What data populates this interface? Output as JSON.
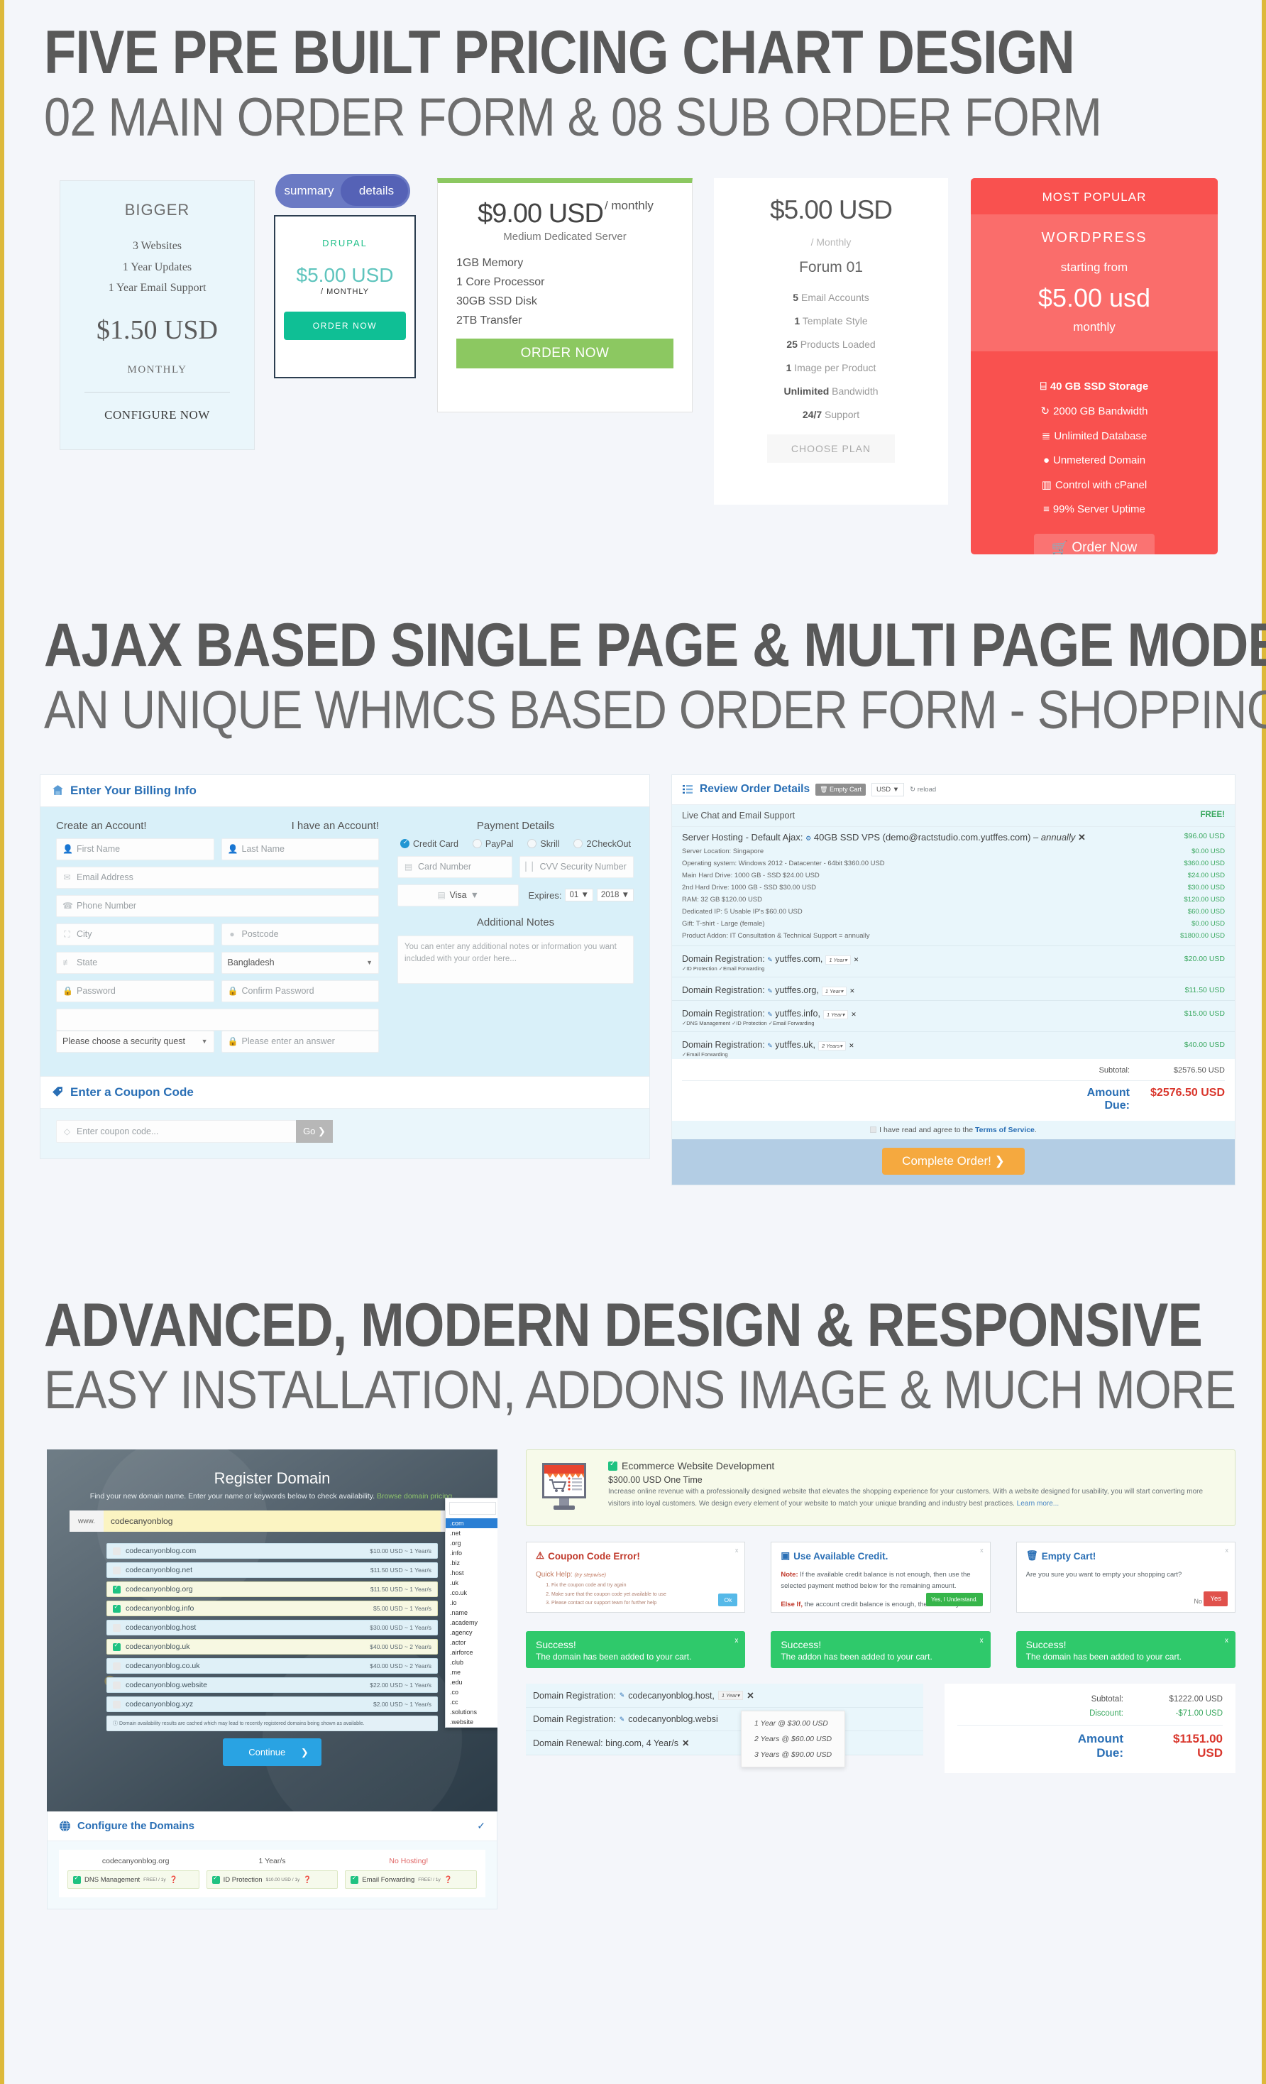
{
  "hero": {
    "line1": "FIVE PRE BUILT PRICING CHART DESIGN",
    "line2": "02 MAIN ORDER FORM & 08 SUB ORDER FORM"
  },
  "hero2": {
    "line1": "AJAX BASED SINGLE PAGE & MULTI PAGE MODE",
    "line2": "AN UNIQUE WHMCS BASED ORDER FORM - SHOPPING CART"
  },
  "hero3": {
    "line1": "ADVANCED, MODERN DESIGN & RESPONSIVE",
    "line2": "EASY INSTALLATION, ADDONS IMAGE & MUCH MORE"
  },
  "colors": {
    "accent_blue": "#2a6fb5",
    "green": "#3aa85f",
    "red": "#f9514f",
    "orange": "#f5a93f",
    "border_gold": "#ddb93a"
  },
  "pricing": {
    "bigger": {
      "title": "BIGGER",
      "features": [
        "3 Websites",
        "1 Year Updates",
        "1 Year Email Support"
      ],
      "price": "$1.50 USD",
      "period": "MONTHLY",
      "cta": "CONFIGURE NOW"
    },
    "drupal": {
      "toggle": {
        "left": "summary",
        "right": "details"
      },
      "brand": "DRUPAL",
      "price": "$5.00 USD",
      "period": "/ MONTHLY",
      "cta": "ORDER NOW"
    },
    "dedicated": {
      "price": "$9.00 USD",
      "period": "/ monthly",
      "subtitle": "Medium Dedicated Server",
      "features": [
        "1GB Memory",
        "1 Core Processor",
        "30GB SSD Disk",
        "2TB Transfer"
      ],
      "cta": "ORDER NOW"
    },
    "forum": {
      "price": "$5.00 USD",
      "period": "/ Monthly",
      "plan": "Forum 01",
      "features": [
        {
          "n": "5",
          "t": "Email Accounts"
        },
        {
          "n": "1",
          "t": "Template Style"
        },
        {
          "n": "25",
          "t": "Products Loaded"
        },
        {
          "n": "1",
          "t": "Image per Product"
        },
        {
          "n": "Unlimited",
          "t": "Bandwidth"
        },
        {
          "n": "24/7",
          "t": "Support"
        }
      ],
      "cta": "CHOOSE PLAN"
    },
    "wordpress": {
      "badge": "MOST POPULAR",
      "brand": "WORDPRESS",
      "from": "starting from",
      "price": "$5.00 usd",
      "period": "monthly",
      "features": [
        {
          "icon": "hdd-icon",
          "glyph": "⌸",
          "label": "40 GB SSD Storage",
          "bold": true
        },
        {
          "icon": "refresh-icon",
          "glyph": "↻",
          "label": "2000 GB Bandwidth",
          "bold": false
        },
        {
          "icon": "database-icon",
          "glyph": "≣",
          "label": "Unlimited Database",
          "bold": false
        },
        {
          "icon": "globe-icon",
          "glyph": "●",
          "label": "Unmetered Domain",
          "bold": false
        },
        {
          "icon": "columns-icon",
          "glyph": "▥",
          "label": "Control with cPanel",
          "bold": false
        },
        {
          "icon": "server-icon",
          "glyph": "≡",
          "label": "99% Server Uptime",
          "bold": false
        }
      ],
      "cta": "Order Now",
      "cta_icon": "cart-icon"
    }
  },
  "billing": {
    "panel_title": "Enter Your Billing Info",
    "panel_icon": "billing-house-icon",
    "create_label": "Create an Account!",
    "have_label": "I have an Account!",
    "fields": {
      "first_name": "First Name",
      "last_name": "Last Name",
      "email": "Email Address",
      "phone": "Phone Number",
      "city": "City",
      "postcode": "Postcode",
      "state": "State",
      "country": "Bangladesh",
      "password": "Password",
      "confirm_password": "Confirm Password",
      "security_question": "Please choose a security quest",
      "security_answer": "Please enter an answer"
    },
    "payment": {
      "title": "Payment Details",
      "methods": [
        {
          "label": "Credit Card",
          "selected": true
        },
        {
          "label": "PayPal",
          "selected": false
        },
        {
          "label": "Skrill",
          "selected": false
        },
        {
          "label": "2CheckOut",
          "selected": false
        }
      ],
      "card_number": "Card Number",
      "cvv": "CVV Security Number",
      "card_type": "Visa",
      "expires_label": "Expires:",
      "expires_month": "01",
      "expires_year": "2018"
    },
    "notes": {
      "title": "Additional Notes",
      "placeholder": "You can enter any additional notes or information you want included with your order here..."
    },
    "coupon": {
      "panel_title": "Enter a Coupon Code",
      "panel_icon": "coupon-tag-icon",
      "placeholder": "Enter coupon code...",
      "go": "Go"
    }
  },
  "review": {
    "title": "Review Order Details",
    "title_icon": "list-icon",
    "empty_cart": "Empty Cart",
    "currency": "USD",
    "reload": "reload",
    "free_row": {
      "label": "Live Chat and Email Support",
      "value": "FREE!"
    },
    "hosting": {
      "label": "Server Hosting - Default Ajax:",
      "product": "40GB SSD VPS (demo@ractstudio.com.yutffes.com)",
      "term": "annually",
      "amount": "$96.00 USD",
      "options": [
        {
          "label": "Server Location: Singapore",
          "amount": "$0.00 USD"
        },
        {
          "label": "Operating system: Windows 2012 - Datacenter - 64bit $360.00 USD",
          "amount": "$360.00 USD"
        },
        {
          "label": "Main Hard Drive: 1000 GB - SSD $24.00 USD",
          "amount": "$24.00 USD"
        },
        {
          "label": "2nd Hard Drive: 1000 GB - SSD $30.00 USD",
          "amount": "$30.00 USD"
        },
        {
          "label": "RAM: 32 GB $120.00 USD",
          "amount": "$120.00 USD"
        },
        {
          "label": "Dedicated IP: 5 Usable IP's $60.00 USD",
          "amount": "$60.00 USD"
        },
        {
          "label": "Gift: T-shirt - Large (female)",
          "amount": "$0.00 USD"
        },
        {
          "label": "Product Addon: IT Consultation & Technical Support = annually",
          "amount": "$1800.00 USD"
        }
      ]
    },
    "domains": [
      {
        "label": "Domain Registration:",
        "name": "yutffes.com,",
        "term": "1 Year",
        "amount": "$20.00 USD",
        "feats": "✓ID Protection ✓Email Forwarding"
      },
      {
        "label": "Domain Registration:",
        "name": "yutffes.org,",
        "term": "1 Year",
        "amount": "$11.50 USD",
        "feats": ""
      },
      {
        "label": "Domain Registration:",
        "name": "yutffes.info,",
        "term": "1 Year",
        "amount": "$15.00 USD",
        "feats": "✓DNS Management ✓ID Protection ✓Email Forwarding"
      },
      {
        "label": "Domain Registration:",
        "name": "yutffes.uk,",
        "term": "2 Years",
        "amount": "$40.00 USD",
        "feats": "✓Email Forwarding"
      }
    ],
    "subtotal_label": "Subtotal:",
    "subtotal_value": "$2576.50 USD",
    "due_label": "Amount Due:",
    "due_value": "$2576.50 USD",
    "tos_pre": "I have read and agree to the",
    "tos_link": "Terms of Service",
    "complete": "Complete Order!"
  },
  "domain_search": {
    "title": "Register Domain",
    "subtitle": "Find your new domain name. Enter your name or keywords below to check availability.",
    "browse_link": "Browse domain pricing.",
    "www": "www.",
    "query": "codecanyonblog",
    "tld": ".com",
    "tld_options": [
      ".com",
      ".net",
      ".org",
      ".info",
      ".biz",
      ".host",
      ".uk",
      ".co.uk",
      ".io",
      ".name",
      ".academy",
      ".agency",
      ".actor",
      ".airforce",
      ".club",
      ".me",
      ".edu",
      ".co",
      ".cc",
      ".solutions",
      ".website"
    ],
    "results": [
      {
        "name": "codecanyonblog.com",
        "price": "$10.00 USD ~ 1 Year/s",
        "selected": false
      },
      {
        "name": "codecanyonblog.net",
        "price": "$11.50 USD ~ 1 Year/s",
        "selected": false
      },
      {
        "name": "codecanyonblog.org",
        "price": "$11.50 USD ~ 1 Year/s",
        "selected": true
      },
      {
        "name": "codecanyonblog.info",
        "price": "$5.00 USD ~ 1 Year/s",
        "selected": true
      },
      {
        "name": "codecanyonblog.host",
        "price": "$30.00 USD ~ 1 Year/s",
        "selected": false
      },
      {
        "name": "codecanyonblog.uk",
        "price": "$40.00 USD ~ 2 Year/s",
        "selected": true
      },
      {
        "name": "codecanyonblog.co.uk",
        "price": "$40.00 USD ~ 2 Year/s",
        "selected": false
      },
      {
        "name": "codecanyonblog.website",
        "price": "$22.00 USD ~ 1 Year/s",
        "selected": false
      },
      {
        "name": "codecanyonblog.xyz",
        "price": "$2.00 USD ~ 1 Year/s",
        "selected": false
      }
    ],
    "note": "Domain availability results are cached which may lead to recently registered domains being shown as available.",
    "continue": "Continue"
  },
  "configure": {
    "title": "Configure the Domains",
    "title_icon": "globe-icon",
    "domain": "codecanyonblog.org",
    "term": "1 Year/s",
    "hosting": "No Hosting!",
    "options": [
      {
        "label": "DNS Management",
        "price": "FREE! / 1y"
      },
      {
        "label": "ID Protection",
        "price": "$10.00 USD / 1y"
      },
      {
        "label": "Email Forwarding",
        "price": "FREE! / 1y"
      }
    ]
  },
  "ecommerce": {
    "title": "Ecommerce Website Development",
    "price": "$300.00 USD One Time",
    "desc": "Increase online revenue with a professionally designed website that elevates the shopping experience for your customers. With a website designed for usability, you will start converting more visitors into loyal customers. We design every element of your website to match your unique branding and industry best practices.",
    "link": "Learn more..."
  },
  "alerts": [
    {
      "kind": "error",
      "icon": "warning-triangle-icon",
      "title": "Coupon Code Error!",
      "quick_help": "Quick Help:",
      "quick_help_note": "(try stepwise)",
      "steps": [
        "Fix the coupon code and try again",
        "Make sure that the coupon code yet available to use",
        "Please contact our support team for further help"
      ],
      "button": "Ok"
    },
    {
      "kind": "info",
      "icon": "credit-icon",
      "title": "Use Available Credit.",
      "note_bold": "Note:",
      "note_text": "If the available credit balance is not enough, then use the selected payment method below for the remaining amount.",
      "else_bold": "Else If,",
      "else_text": "the account credit balance is enough, therefore only use it.",
      "button": "Yes, I Understand."
    },
    {
      "kind": "info",
      "icon": "trash-icon",
      "title": "Empty Cart!",
      "body": "Are you sure you want to empty your shopping cart?",
      "button_no": "No",
      "button_yes": "Yes"
    }
  ],
  "toasts": [
    {
      "title": "Success!",
      "text": "The domain has been added to your cart."
    },
    {
      "title": "Success!",
      "text": "The addon has been added to your cart."
    },
    {
      "title": "Success!",
      "text": "The domain has been added to your cart."
    }
  ],
  "cart_bottom": {
    "lines": [
      {
        "label": "Domain Registration:",
        "name": "codecanyonblog.host,",
        "term": "1 Year",
        "icon": "pencil-icon"
      },
      {
        "label": "Domain Registration:",
        "name": "codecanyonblog.websi",
        "term": "",
        "icon": "pencil-icon"
      },
      {
        "label": "Domain Renewal: bing.com, 4 Year/s",
        "name": "",
        "term": "",
        "icon": ""
      }
    ],
    "term_options": [
      "1 Year @ $30.00 USD",
      "2 Years @ $60.00 USD",
      "3 Years @ $90.00 USD"
    ],
    "subtotal_label": "Subtotal:",
    "subtotal_value": "$1222.00 USD",
    "discount_label": "Discount:",
    "discount_value": "-$71.00 USD",
    "due_label": "Amount Due:",
    "due_value": "$1151.00 USD"
  }
}
